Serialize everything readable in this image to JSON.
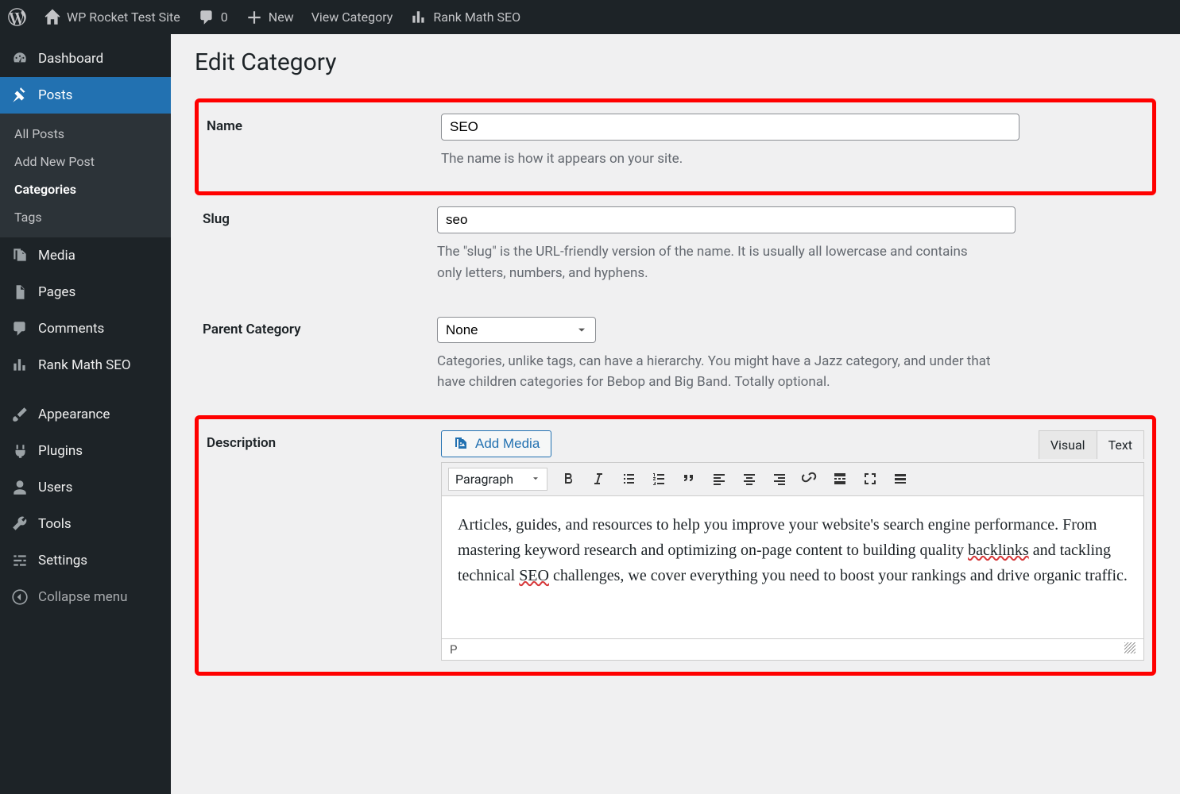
{
  "toolbar": {
    "site_name": "WP Rocket Test Site",
    "comment_count": "0",
    "new_label": "New",
    "view_label": "View Category",
    "seo_label": "Rank Math SEO"
  },
  "sidebar": {
    "dashboard": "Dashboard",
    "posts": "Posts",
    "submenu": {
      "all": "All Posts",
      "addnew": "Add New Post",
      "categories": "Categories",
      "tags": "Tags"
    },
    "media": "Media",
    "pages": "Pages",
    "comments": "Comments",
    "rankmath": "Rank Math SEO",
    "appearance": "Appearance",
    "plugins": "Plugins",
    "users": "Users",
    "tools": "Tools",
    "settings": "Settings",
    "collapse": "Collapse menu"
  },
  "page": {
    "title": "Edit Category",
    "name_label": "Name",
    "name_value": "SEO",
    "name_help": "The name is how it appears on your site.",
    "slug_label": "Slug",
    "slug_value": "seo",
    "slug_help": "The \"slug\" is the URL-friendly version of the name. It is usually all lowercase and contains only letters, numbers, and hyphens.",
    "parent_label": "Parent Category",
    "parent_value": "None",
    "parent_help": "Categories, unlike tags, can have a hierarchy. You might have a Jazz category, and under that have children categories for Bebop and Big Band. Totally optional.",
    "desc_label": "Description",
    "add_media": "Add Media",
    "tab_visual": "Visual",
    "tab_text": "Text",
    "format_label": "Paragraph",
    "desc_pre": "Articles, guides, and resources to help you improve your website's search engine performance. From mastering keyword research and optimizing on-page content to building quality ",
    "desc_word1": "backlinks",
    "desc_mid": " and tackling technical ",
    "desc_word2": "SEO",
    "desc_post": " challenges, we cover everything you need to boost your rankings and drive organic traffic.",
    "status_path": "P"
  }
}
